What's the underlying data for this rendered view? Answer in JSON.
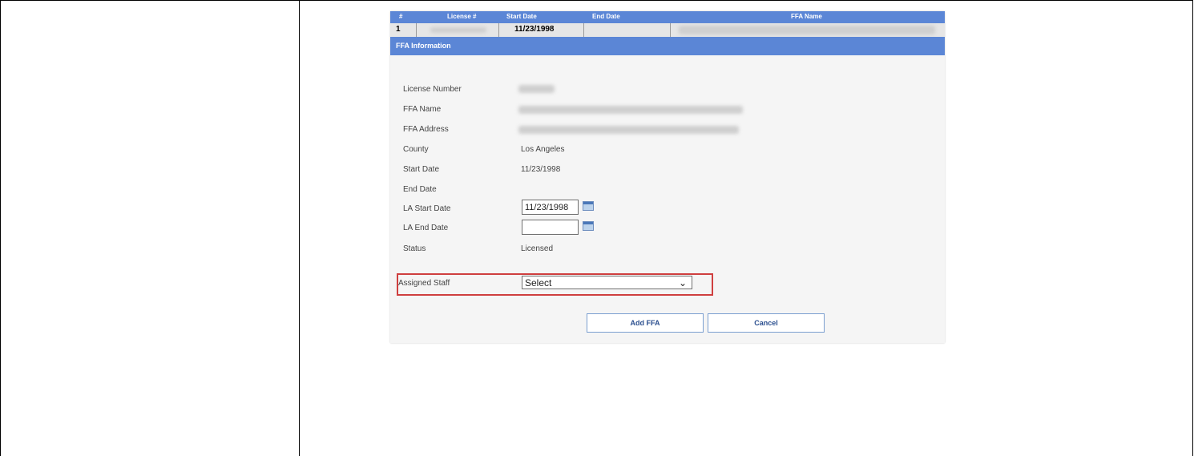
{
  "grid": {
    "headers": [
      "#",
      "License #",
      "Start Date",
      "End Date",
      "FFA Name"
    ],
    "row": {
      "index": "1",
      "start_date": "11/23/1998"
    }
  },
  "section": {
    "title": "FFA Information"
  },
  "form": {
    "license_number_label": "License Number",
    "ffa_name_label": "FFA Name",
    "ffa_address_label": "FFA Address",
    "county_label": "County",
    "county_value": "Los Angeles",
    "start_date_label": "Start Date",
    "start_date_value": "11/23/1998",
    "end_date_label": "End Date",
    "la_start_date_label": "LA Start Date",
    "la_start_date_value": "11/23/1998",
    "la_end_date_label": "LA End Date",
    "la_end_date_value": "",
    "status_label": "Status",
    "status_value": "Licensed",
    "assigned_staff_label": "Assigned Staff",
    "assigned_staff_value": "Select"
  },
  "icons": {
    "calendar": "calendar-icon",
    "dropdown": "chevron-down-icon"
  },
  "buttons": {
    "add": "Add FFA",
    "cancel": "Cancel"
  },
  "colors": {
    "header_blue": "#5b86d6",
    "highlight_red": "#cf3f3f"
  }
}
